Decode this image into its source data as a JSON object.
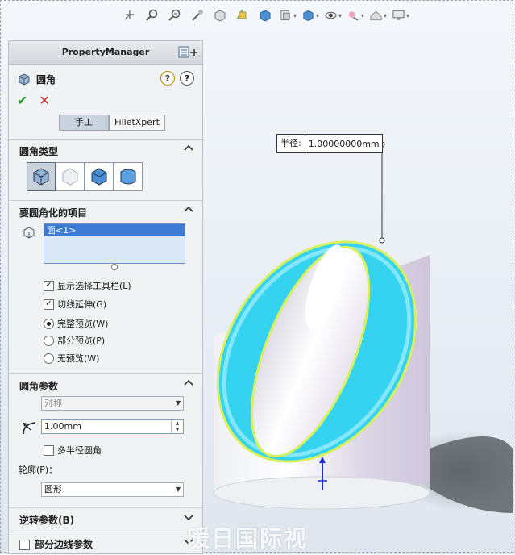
{
  "toolbar": {
    "icons": [
      "zoom-to-fit-icon",
      "zoom-area-icon",
      "previous-view-icon",
      "section-view-icon",
      "view-orientation-icon",
      "display-style-icon",
      "hide-show-items-icon",
      "edit-appearance-icon",
      "apply-scene-icon",
      "view-settings-icon",
      "display-monitor-icon"
    ]
  },
  "panel": {
    "header_title": "PropertyManager",
    "feature_name": "圆角",
    "help1": "?",
    "help2": "?",
    "ok": "✔",
    "cancel": "✕",
    "tab_manual": "手工",
    "tab_xpert": "FilletXpert",
    "sections": {
      "fillet_type": "圆角类型",
      "items": "要圆角化的项目",
      "params": "圆角参数",
      "setback": "逆转参数(B)",
      "partial_edge": "部分边线参数"
    },
    "selected_item": "面<1>",
    "show_selection_toolbar": "显示选择工具栏(L)",
    "tangent_propagation": "切线延伸(G)",
    "preview_full": "完整预览(W)",
    "preview_partial": "部分预览(P)",
    "preview_none": "无预览(W)",
    "symmetric": "对称",
    "radius_value": "1.00mm",
    "multi_radius": "多半径圆角",
    "profile_label": "轮廓(P)：",
    "profile_value": "圆形"
  },
  "viewport": {
    "dim_label": "半径:",
    "dim_value": "1.00000000mm",
    "watermark": "暖日国际视"
  },
  "colors": {
    "highlight": "#35d3f0",
    "outline": "#d8f05a",
    "selected_item": "#3d7bd6"
  }
}
